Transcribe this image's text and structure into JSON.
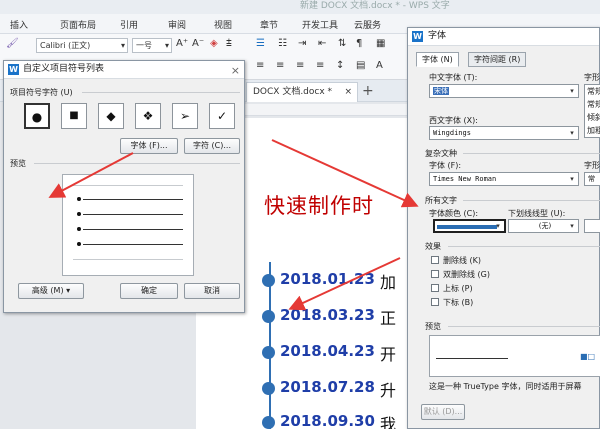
{
  "window": {
    "title": "新建 DOCX 文档.docx * - WPS 文字",
    "menu": [
      "插入",
      "页面布局",
      "引用",
      "审阅",
      "视图",
      "章节",
      "开发工具",
      "云服务"
    ],
    "font_name": "Calibri (正文)",
    "font_size": "一号",
    "doc_tab": "DOCX 文档.docx *",
    "tab_close": "×",
    "tab_add": "+"
  },
  "document": {
    "heading": "快速制作时",
    "timeline": [
      {
        "date": "2018.01.23",
        "text": "加"
      },
      {
        "date": "2018.03.23",
        "text": "正"
      },
      {
        "date": "2018.04.23",
        "text": "开"
      },
      {
        "date": "2018.07.28",
        "text": "升"
      },
      {
        "date": "2018.09.30",
        "text": "我"
      }
    ],
    "timeline_color": "#2f6fb3",
    "heading_color": "#c00000"
  },
  "bullet_dialog": {
    "title": "自定义项目符号列表",
    "close": "×",
    "section_symbol": "项目符号字符 (U)",
    "symbols": [
      "●",
      "■",
      "◆",
      "❖",
      "➢",
      "✓"
    ],
    "font_button": "字体 (F)...",
    "char_button": "字符 (C)...",
    "section_preview": "预览",
    "advanced_button": "高级 (M) ▾",
    "ok_button": "确定",
    "cancel_button": "取消"
  },
  "font_dialog": {
    "title": "字体",
    "tabs": [
      "字体 (N)",
      "字符间距 (R)"
    ],
    "cn_font_label": "中文字体 (T):",
    "cn_font_value": "宋体",
    "style_label": "字形",
    "style_options": [
      "常规",
      "常规",
      "倾斜",
      "加粗"
    ],
    "west_font_label": "西文字体 (X):",
    "west_font_value": "Wingdings",
    "complex_section": "复杂文种",
    "complex_font_label": "字体 (F):",
    "complex_font_value": "Times New Roman",
    "complex_style_label": "字形",
    "complex_style_value": "常规",
    "all_text_section": "所有文字",
    "color_label": "字体颜色 (C):",
    "color_value": "#2a6db3",
    "underline_label": "下划线线型 (U):",
    "underline_value": "(无)",
    "effects_section": "效果",
    "effects": [
      "删除线 (K)",
      "双删除线 (G)",
      "上标 (P)",
      "下标 (B)"
    ],
    "preview_section": "预览",
    "preview_sample": "■□",
    "note": "这是一种 TrueType 字体，同时适用于屏幕",
    "default_button": "默认 (D)..."
  }
}
